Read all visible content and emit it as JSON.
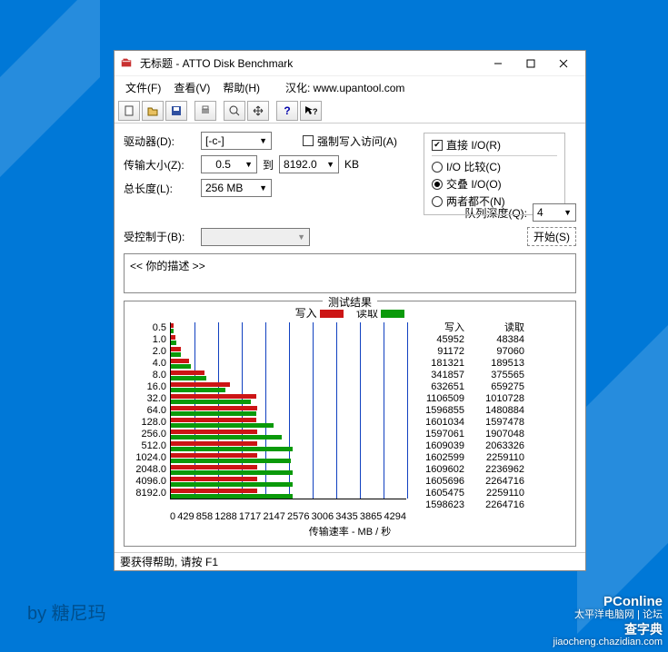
{
  "window": {
    "title": "无标题 - ATTO Disk Benchmark",
    "menu": {
      "file": "文件(F)",
      "view": "查看(V)",
      "help": "帮助(H)",
      "localize": "汉化: www.upantool.com"
    }
  },
  "toolbar_icons": [
    "new-file",
    "open-file",
    "save-file",
    "print",
    "preview",
    "move",
    "help",
    "whatsthis"
  ],
  "form": {
    "drive_label": "驱动器(D):",
    "drive_value": "[-c-]",
    "transfer_label": "传输大小(Z):",
    "transfer_from": "0.5",
    "to_label": "到",
    "transfer_to": "8192.0",
    "unit": "KB",
    "length_label": "总长度(L):",
    "length_value": "256 MB",
    "force_write": "强制写入访问(A)",
    "direct_io": "直接 I/O(R)",
    "io_compare": "I/O 比较(C)",
    "overlap_io": "交叠 I/O(O)",
    "neither": "两者都不(N)",
    "queue_label": "队列深度(Q):",
    "queue_value": "4",
    "controlled_label": "受控制于(B):",
    "start": "开始(S)"
  },
  "desc": {
    "text": "<<   你的描述    >>"
  },
  "results": {
    "title": "测试结果",
    "legend_write": "写入",
    "legend_read": "读取",
    "head_write": "写入",
    "head_read": "读取",
    "xaxis_label": "传输速率 - MB / 秒"
  },
  "status": {
    "text": "要获得帮助, 请按 F1"
  },
  "watermarks": {
    "bl": "by 糖尼玛",
    "br1": "PConline",
    "br2": "太平洋电脑网 | 论坛",
    "br3": "查字典",
    "br4": "jiaocheng.chazidian.com"
  },
  "chart_data": {
    "type": "bar",
    "categories": [
      "0.5",
      "1.0",
      "2.0",
      "4.0",
      "8.0",
      "16.0",
      "32.0",
      "64.0",
      "128.0",
      "256.0",
      "512.0",
      "1024.0",
      "2048.0",
      "4096.0",
      "8192.0"
    ],
    "series": [
      {
        "name": "写入",
        "values": [
          45952,
          91172,
          181321,
          341857,
          632651,
          1106509,
          1596855,
          1601034,
          1597061,
          1609039,
          1602599,
          1609602,
          1605696,
          1605475,
          1598623
        ]
      },
      {
        "name": "读取",
        "values": [
          48384,
          97060,
          189513,
          375565,
          659275,
          1010728,
          1480884,
          1597478,
          1907048,
          2063326,
          2259110,
          2236962,
          2264716,
          2259110,
          2264716
        ]
      }
    ],
    "xticks": [
      0,
      429,
      858,
      1288,
      1717,
      2147,
      2576,
      3006,
      3435,
      3865,
      4294
    ],
    "xmax": 4294,
    "xlabel": "传输速率 - MB / 秒"
  }
}
